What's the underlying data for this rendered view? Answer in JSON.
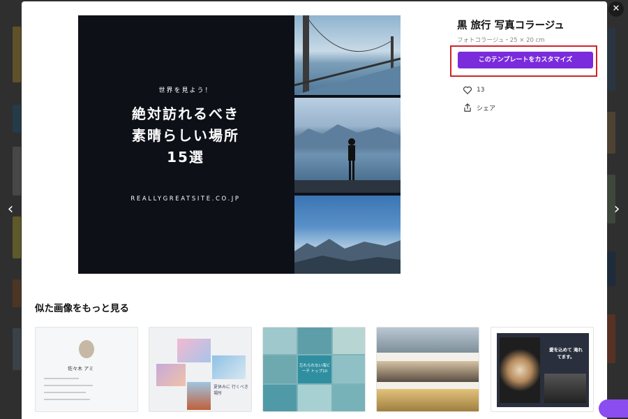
{
  "modal": {
    "title": "黒 旅行 写真コラージュ",
    "subtitle": "フォトコラージュ・25 × 20 cm",
    "customize_label": "このテンプレートをカスタマイズ",
    "likes_count": "13",
    "share_label": "シェア",
    "close_glyph": "✕",
    "similar_heading": "似た画像をもっと見る"
  },
  "preview": {
    "kicker": "世界を見よう！",
    "heading_line1": "絶対訪れるべき",
    "heading_line2": "素晴らしい場所",
    "heading_line3": "15選",
    "site": "REALLYGREATSITE.CO.JP"
  },
  "nav": {
    "prev_glyph": "‹",
    "next_glyph": "›"
  },
  "thumbnails": [
    {
      "text": "佐々木 アミ"
    },
    {
      "text": "夏休みに 行くべき場所"
    },
    {
      "text": "忘れられない海ビーチ トップ10"
    },
    {
      "text": ""
    },
    {
      "text": "愛を込めて 淹れてます。"
    }
  ],
  "colors": {
    "accent": "#7a2bdc",
    "highlight": "#d0222a",
    "preview_bg": "#0d1017"
  }
}
